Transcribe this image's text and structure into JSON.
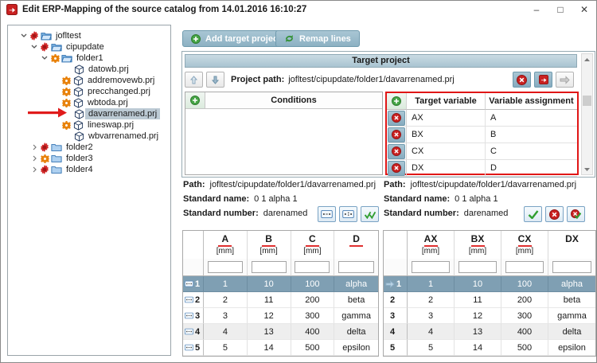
{
  "colors": {
    "accent_red": "#cf1f1f",
    "steel_button": "#8db1c3",
    "header_bar": "#aec8d4",
    "row_selection": "#7f9fb3",
    "tree_selection": "#bccad4",
    "green": "#3f9e3f",
    "gear_orange": "#e8820c",
    "column_underline": "#e03030"
  },
  "window": {
    "title": "Edit ERP-Mapping of the source catalog from 14.01.2016 16:10:27",
    "controls": {
      "minimize": "–",
      "maximize": "□",
      "close": "✕"
    }
  },
  "toolbar": {
    "add_target_project": "Add target project",
    "remap_lines": "Remap lines"
  },
  "tree": {
    "items": [
      {
        "label": "jofltest"
      },
      {
        "label": "cipupdate"
      },
      {
        "label": "folder1"
      },
      {
        "label": "datowb.prj"
      },
      {
        "label": "addremovewb.prj"
      },
      {
        "label": "precchanged.prj"
      },
      {
        "label": "wbtoda.prj"
      },
      {
        "label": "davarrenamed.prj"
      },
      {
        "label": "lineswap.prj"
      },
      {
        "label": "wbvarrenamed.prj"
      },
      {
        "label": "folder2"
      },
      {
        "label": "folder3"
      },
      {
        "label": "folder4"
      }
    ]
  },
  "target_project": {
    "header": "Target project",
    "project_path_label": "Project path:",
    "project_path": "jofltest/cipupdate/folder1/davarrenamed.prj",
    "conditions": {
      "title": "Conditions"
    },
    "variables": {
      "target_column": "Target variable",
      "assignment_column": "Variable assignment",
      "rows": [
        {
          "target": "AX",
          "assignment": "A"
        },
        {
          "target": "BX",
          "assignment": "B"
        },
        {
          "target": "CX",
          "assignment": "C"
        },
        {
          "target": "DX",
          "assignment": "D"
        }
      ]
    }
  },
  "source_info": {
    "path_label": "Path:",
    "path": "jofltest/cipupdate/folder1/davarrenamed.prj",
    "standard_name_label": "Standard name:",
    "standard_name": "0 1 alpha 1",
    "standard_number_label": "Standard number:",
    "standard_number": "darenamed"
  },
  "target_info": {
    "path_label": "Path:",
    "path": "jofltest/cipupdate/folder1/davarrenamed.prj",
    "standard_name_label": "Standard name:",
    "standard_name": "0 1 alpha 1",
    "standard_number_label": "Standard number:",
    "standard_number": "darenamed"
  },
  "source_table": {
    "columns": [
      {
        "name": "A",
        "unit": "[mm]"
      },
      {
        "name": "B",
        "unit": "[mm]"
      },
      {
        "name": "C",
        "unit": "[mm]"
      },
      {
        "name": "D",
        "unit": ""
      }
    ],
    "filters": [
      "",
      "",
      "",
      ""
    ],
    "rows": [
      {
        "num": "1",
        "cells": [
          "1",
          "10",
          "100",
          "alpha"
        ]
      },
      {
        "num": "2",
        "cells": [
          "2",
          "11",
          "200",
          "beta"
        ]
      },
      {
        "num": "3",
        "cells": [
          "3",
          "12",
          "300",
          "gamma"
        ]
      },
      {
        "num": "4",
        "cells": [
          "4",
          "13",
          "400",
          "delta"
        ]
      },
      {
        "num": "5",
        "cells": [
          "5",
          "14",
          "500",
          "epsilon"
        ]
      }
    ]
  },
  "target_table": {
    "columns": [
      {
        "name": "AX",
        "unit": "[mm]"
      },
      {
        "name": "BX",
        "unit": "[mm]"
      },
      {
        "name": "CX",
        "unit": "[mm]"
      },
      {
        "name": "DX",
        "unit": ""
      }
    ],
    "filters": [
      "",
      "",
      "",
      ""
    ],
    "rows": [
      {
        "num": "1",
        "cells": [
          "1",
          "10",
          "100",
          "alpha"
        ]
      },
      {
        "num": "2",
        "cells": [
          "2",
          "11",
          "200",
          "beta"
        ]
      },
      {
        "num": "3",
        "cells": [
          "3",
          "12",
          "300",
          "gamma"
        ]
      },
      {
        "num": "4",
        "cells": [
          "4",
          "13",
          "400",
          "delta"
        ]
      },
      {
        "num": "5",
        "cells": [
          "5",
          "14",
          "500",
          "epsilon"
        ]
      }
    ]
  }
}
